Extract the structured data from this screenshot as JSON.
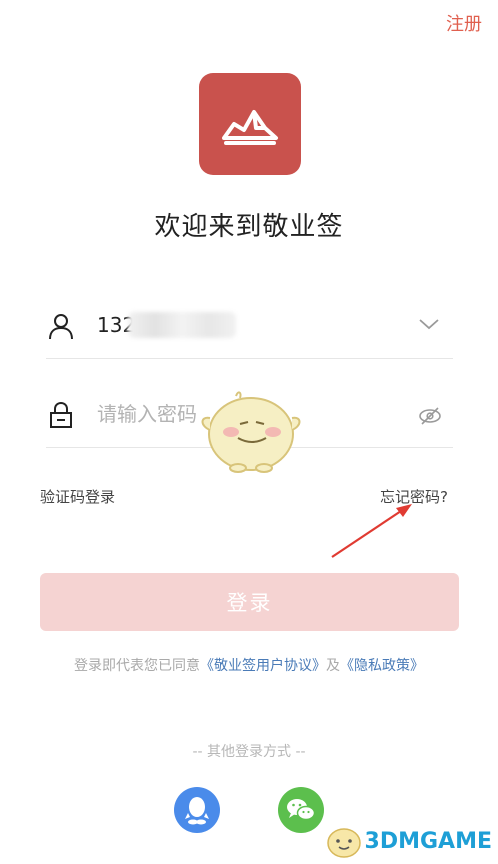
{
  "header": {
    "register_label": "注册"
  },
  "welcome_title": "欢迎来到敬业签",
  "login_form": {
    "phone_value": "132",
    "password_placeholder": "请输入密码",
    "sms_login_label": "验证码登录",
    "forgot_password_label": "忘记密码?",
    "login_button_label": "登录"
  },
  "agreement": {
    "prefix": "登录即代表您已同意",
    "user_agreement": "《敬业签用户协议》",
    "and": "及",
    "privacy_policy": "《隐私政策》"
  },
  "other_login": {
    "label": "-- 其他登录方式 --",
    "providers": [
      "qq-icon",
      "wechat-icon"
    ]
  },
  "watermark": "3DMGAME",
  "colors": {
    "brand": "#c9524d",
    "register": "#e0604f",
    "login_button_disabled": "#f5d3d2",
    "link": "#4a7bb7",
    "qq": "#4a8bea",
    "wechat": "#5cbf4d",
    "annotation_arrow": "#e03b32"
  }
}
